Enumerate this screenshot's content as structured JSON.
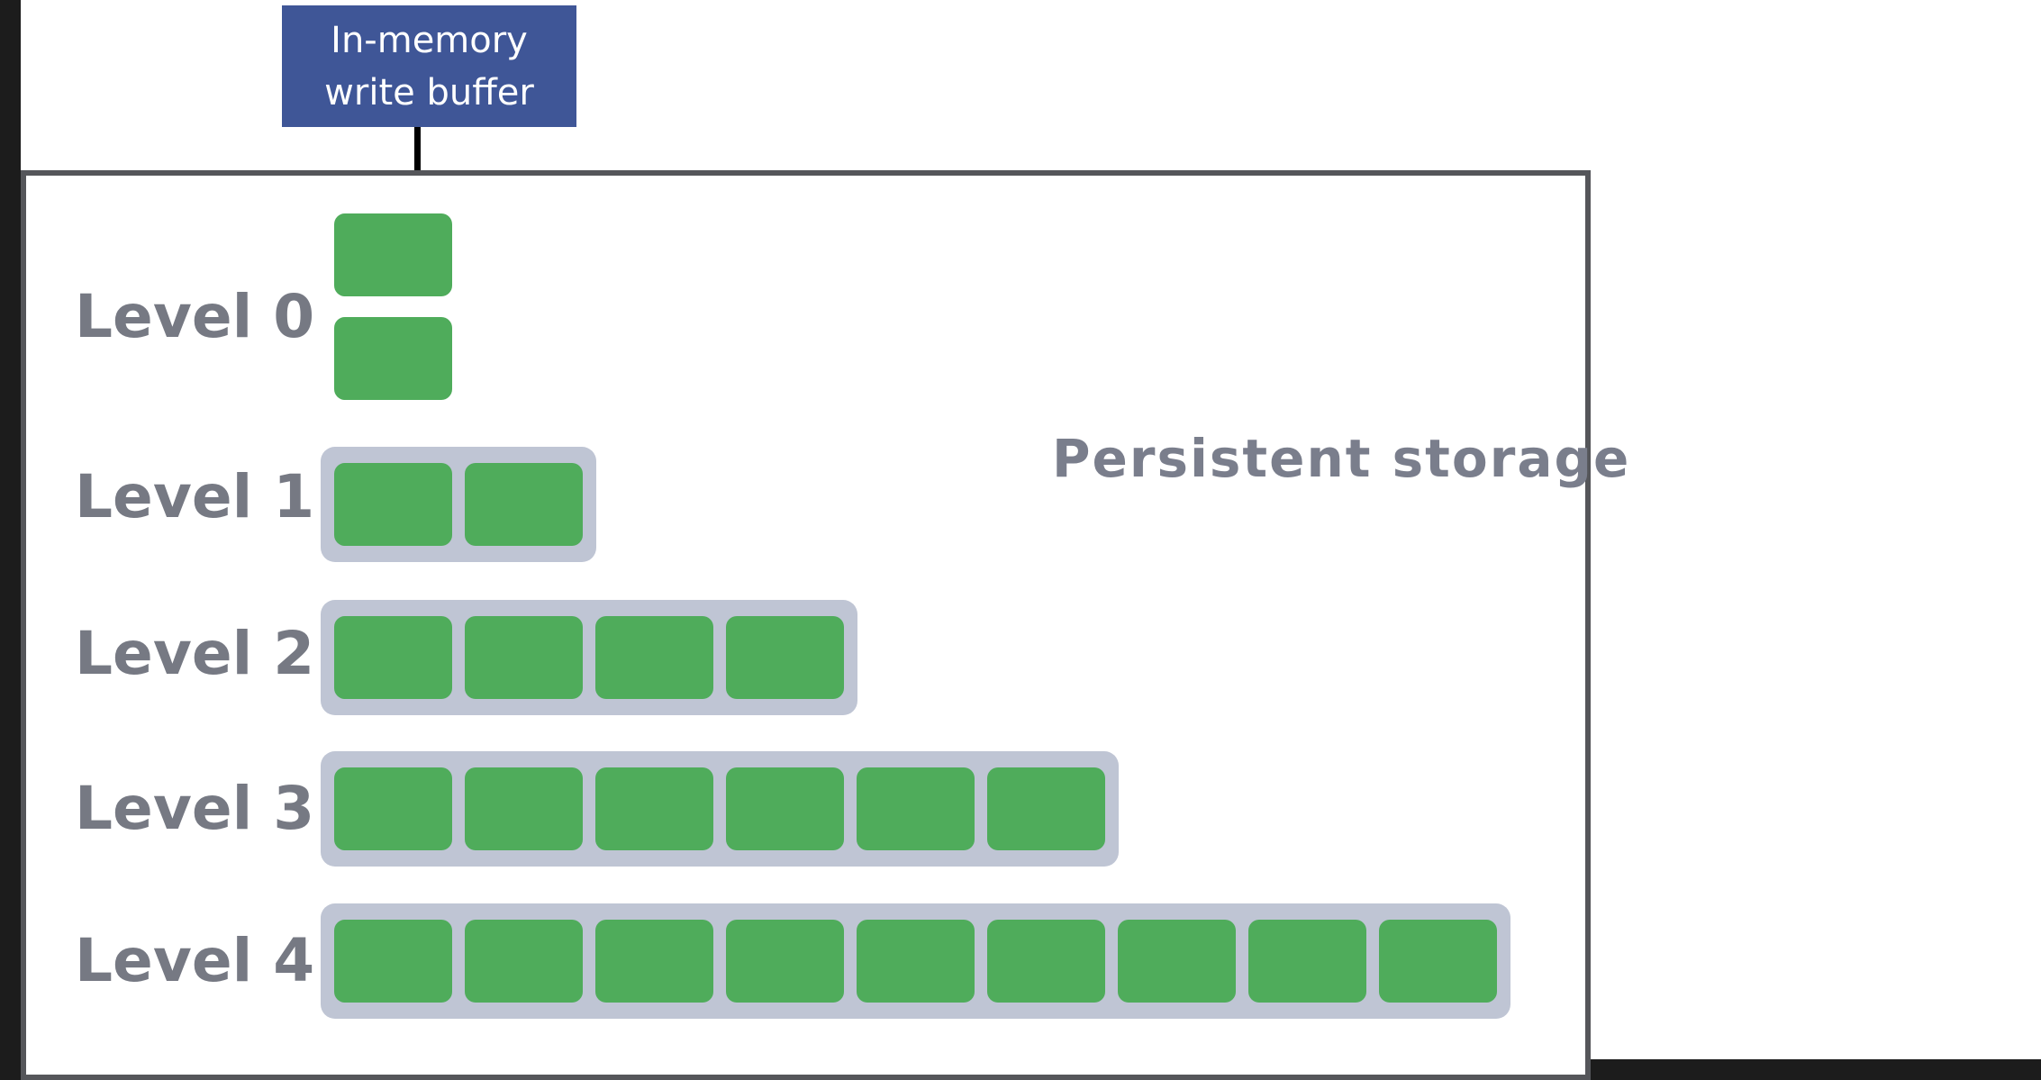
{
  "diagram": {
    "buffer": {
      "line1": "In-memory",
      "line2": "write buffer"
    },
    "storage_label": "Persistent storage",
    "block_color": "#4fac5b",
    "level_box_color": "#bfc5d4",
    "buffer_color": "#3f5697",
    "levels": [
      {
        "label": "Level 0",
        "blocks": 2
      },
      {
        "label": "Level 1",
        "blocks": 2
      },
      {
        "label": "Level 2",
        "blocks": 4
      },
      {
        "label": "Level 3",
        "blocks": 6
      },
      {
        "label": "Level 4",
        "blocks": 9
      }
    ]
  }
}
